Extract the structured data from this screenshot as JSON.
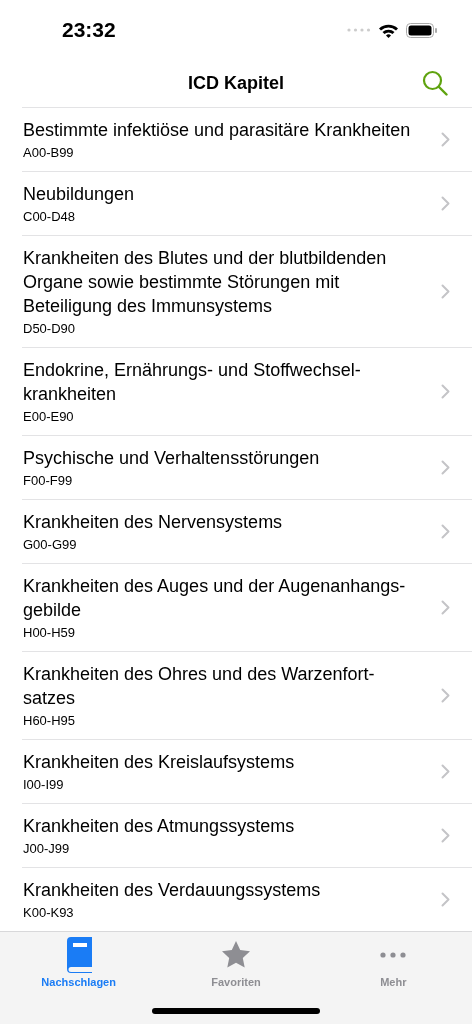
{
  "status_bar": {
    "time": "23:32"
  },
  "nav_bar": {
    "title": "ICD Kapitel"
  },
  "chapters": [
    {
      "title": "Bestimmte infektiöse und parasitäre Krankheiten",
      "code": "A00-B99"
    },
    {
      "title": "Neubildungen",
      "code": "C00-D48"
    },
    {
      "title": "Krankheiten des Blutes und der blutbildenden\nOrgane sowie bestimmte Störungen mit\nBeteiligung des Immunsystems",
      "code": "D50-D90"
    },
    {
      "title": "Endokrine, Ernährungs- und Stoffwechsel-\nkrankheiten",
      "code": "E00-E90"
    },
    {
      "title": "Psychische und Verhaltensstörungen",
      "code": "F00-F99"
    },
    {
      "title": "Krankheiten des Nervensystems",
      "code": "G00-G99"
    },
    {
      "title": "Krankheiten des Auges und der Augenanhangs-\ngebilde",
      "code": "H00-H59"
    },
    {
      "title": "Krankheiten des Ohres und des Warzenfort-\nsatzes",
      "code": "H60-H95"
    },
    {
      "title": "Krankheiten des Kreislaufsystems",
      "code": "I00-I99"
    },
    {
      "title": "Krankheiten des Atmungssystems",
      "code": "J00-J99"
    },
    {
      "title": "Krankheiten des Verdauungssystems",
      "code": "K00-K93"
    }
  ],
  "tab_bar": [
    {
      "kind": "book",
      "label": "Nachschlagen",
      "selected": true
    },
    {
      "kind": "star",
      "label": "Favoriten",
      "selected": false
    },
    {
      "kind": "more",
      "label": "Mehr",
      "selected": false
    }
  ]
}
